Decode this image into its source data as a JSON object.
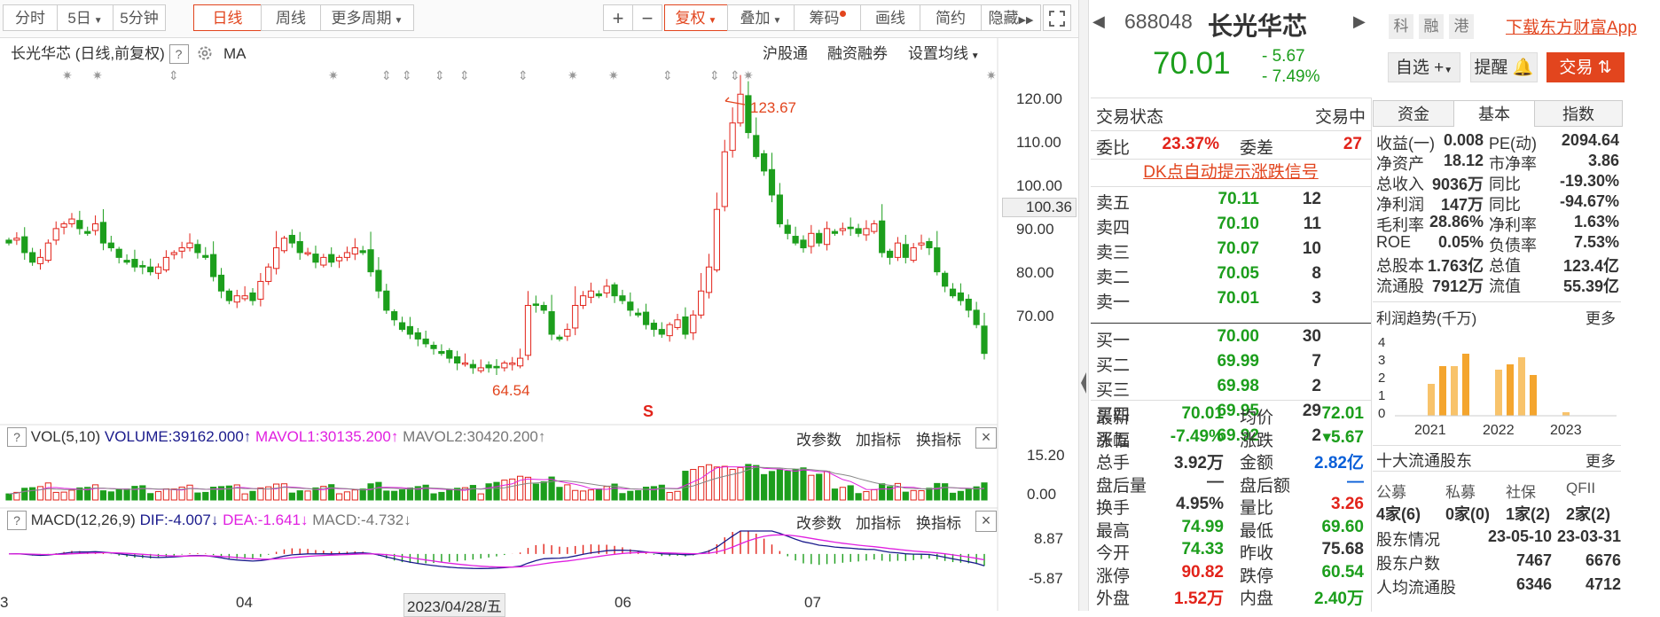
{
  "toolbar": {
    "periods": [
      "分时",
      "5日",
      "5分钟",
      "日线",
      "周线",
      "更多周期"
    ],
    "tools": [
      "+",
      "−",
      "复权",
      "叠加",
      "筹码",
      "画线",
      "简约",
      "隐藏"
    ]
  },
  "chart": {
    "header_name": "长光华芯",
    "header_mode": "(日线,前复权)",
    "header_ma": "MA",
    "links": [
      "沪股通",
      "融资融券",
      "设置均线"
    ],
    "price_high_label": "123.67",
    "price_low_label": "64.54",
    "current_marker": "100.36",
    "signal_mark": "S",
    "yticks": [
      "120.00",
      "110.00",
      "100.00",
      "90.00",
      "80.00",
      "70.00"
    ],
    "xticks": [
      "3",
      "04",
      "2023/04/28/五",
      "06",
      "07"
    ]
  },
  "volume": {
    "title": "VOL(5,10)",
    "volume": "VOLUME:39162.000",
    "mavol1": "MAVOL1:30135.200",
    "mavol2": "MAVOL2:30420.200",
    "ytop": "15.20",
    "ybottom": "0.00",
    "buttons": [
      "改参数",
      "加指标",
      "换指标"
    ]
  },
  "macd": {
    "title": "MACD(12,26,9)",
    "dif": "DIF:-4.007",
    "dea": "DEA:-1.641",
    "macd": "MACD:-4.732",
    "ytop": "8.87",
    "ybottom": "-5.87",
    "buttons": [
      "改参数",
      "加指标",
      "换指标"
    ]
  },
  "stock": {
    "code": "688048",
    "name": "长光华芯",
    "tags": [
      "科",
      "融",
      "港"
    ],
    "download": "下载东方财富App",
    "price": "70.01",
    "change": "- 5.67",
    "change_pct": "- 7.49%",
    "btn_watch": "自选",
    "btn_alert": "提醒",
    "btn_trade": "交易"
  },
  "status": {
    "label": "交易状态",
    "value": "交易中"
  },
  "ratio": {
    "wb_label": "委比",
    "wb_value": "23.37%",
    "wc_label": "委差",
    "wc_value": "27"
  },
  "dk": "DK点自动提示涨跌信号",
  "asks": [
    {
      "label": "卖五",
      "price": "70.11",
      "vol": "12"
    },
    {
      "label": "卖四",
      "price": "70.10",
      "vol": "11"
    },
    {
      "label": "卖三",
      "price": "70.07",
      "vol": "10"
    },
    {
      "label": "卖二",
      "price": "70.05",
      "vol": "8"
    },
    {
      "label": "卖一",
      "price": "70.01",
      "vol": "3"
    }
  ],
  "bids": [
    {
      "label": "买一",
      "price": "70.00",
      "vol": "30"
    },
    {
      "label": "买二",
      "price": "69.99",
      "vol": "7"
    },
    {
      "label": "买三",
      "price": "69.98",
      "vol": "2"
    },
    {
      "label": "买四",
      "price": "69.95",
      "vol": "29"
    },
    {
      "label": "买五",
      "price": "69.92",
      "vol": "2"
    }
  ],
  "quote": [
    {
      "l1": "最新",
      "v1": "70.01",
      "c1": "green",
      "l2": "均价",
      "v2": "72.01",
      "c2": "green"
    },
    {
      "l1": "涨幅",
      "v1": "-7.49%",
      "c1": "green",
      "l2": "涨跌",
      "v2": "▾5.67",
      "c2": "green"
    },
    {
      "l1": "总手",
      "v1": "3.92万",
      "c1": "black",
      "l2": "金额",
      "v2": "2.82亿",
      "c2": "blue"
    },
    {
      "l1": "盘后量",
      "v1": "—",
      "c1": "black",
      "l2": "盘后额",
      "v2": "—",
      "c2": "blue"
    },
    {
      "l1": "换手",
      "v1": "4.95%",
      "c1": "black",
      "l2": "量比",
      "v2": "3.26",
      "c2": "red"
    },
    {
      "l1": "最高",
      "v1": "74.99",
      "c1": "green",
      "l2": "最低",
      "v2": "69.60",
      "c2": "green"
    },
    {
      "l1": "今开",
      "v1": "74.33",
      "c1": "green",
      "l2": "昨收",
      "v2": "75.68",
      "c2": "black"
    },
    {
      "l1": "涨停",
      "v1": "90.82",
      "c1": "red",
      "l2": "跌停",
      "v2": "60.54",
      "c2": "green"
    },
    {
      "l1": "外盘",
      "v1": "1.52万",
      "c1": "red",
      "l2": "内盘",
      "v2": "2.40万",
      "c2": "green"
    }
  ],
  "tabs": [
    "资金",
    "基本",
    "指数"
  ],
  "fundamentals": [
    {
      "l1": "收益(一)",
      "v1": "0.008",
      "l2": "PE(动)",
      "v2": "2094.64"
    },
    {
      "l1": "净资产",
      "v1": "18.12",
      "l2": "市净率",
      "v2": "3.86"
    },
    {
      "l1": "总收入",
      "v1": "9036万",
      "l2": "同比",
      "v2": "-19.30%"
    },
    {
      "l1": "净利润",
      "v1": "147万",
      "l2": "同比",
      "v2": "-94.67%"
    },
    {
      "l1": "毛利率",
      "v1": "28.86%",
      "l2": "净利率",
      "v2": "1.63%"
    },
    {
      "l1": "ROE",
      "v1": "0.05%",
      "l2": "负债率",
      "v2": "7.53%"
    },
    {
      "l1": "总股本",
      "v1": "1.763亿",
      "l2": "总值",
      "v2": "123.4亿"
    },
    {
      "l1": "流通股",
      "v1": "7912万",
      "l2": "流值",
      "v2": "55.39亿"
    }
  ],
  "profit": {
    "title": "利润趋势(千万)",
    "more": "更多",
    "yticks": [
      "4",
      "3",
      "2",
      "1",
      "0"
    ],
    "years": [
      "2021",
      "2022",
      "2023"
    ]
  },
  "holders": {
    "title": "十大流通股东",
    "more": "更多",
    "types": [
      "公募",
      "私募",
      "社保",
      "QFII"
    ],
    "counts": [
      "4家(6)",
      "0家(0)",
      "1家(2)",
      "2家(2)"
    ],
    "rows": [
      {
        "label": "股东情况",
        "v1": "23-05-10",
        "v2": "23-03-31"
      },
      {
        "label": "股东户数",
        "v1": "7467",
        "v2": "6676"
      },
      {
        "label": "人均流通股",
        "v1": "6346",
        "v2": "4712"
      }
    ]
  },
  "colors": {
    "up": "#e2231a",
    "down": "#1c9e1c",
    "accent": "#e2451e",
    "blue": "#0a5fd8"
  },
  "chart_data": {
    "type": "candlestick",
    "title": "长光华芯 (日线,前复权)",
    "ylim": [
      62,
      127
    ],
    "annotations": {
      "high": 123.67,
      "low": 64.54,
      "marker": 100.36
    },
    "close": [
      93,
      94,
      91,
      89,
      90,
      93,
      96,
      97,
      98,
      96,
      95,
      97,
      93,
      92,
      90,
      89,
      88,
      88,
      87,
      88,
      90,
      91,
      92,
      93,
      91,
      90,
      86,
      83,
      81,
      82,
      82,
      81,
      85,
      88,
      92,
      94,
      93,
      91,
      91,
      89,
      90,
      89,
      90,
      91,
      92,
      91,
      87,
      83,
      79,
      77,
      75,
      74,
      73,
      72,
      71,
      70,
      69,
      68,
      68,
      67,
      67,
      67,
      67,
      68,
      68,
      69,
      80,
      80,
      79,
      74,
      73,
      75,
      80,
      82,
      83,
      82,
      84,
      82,
      81,
      79,
      78,
      76,
      75,
      74,
      76,
      77,
      74,
      78,
      83,
      88,
      100,
      112,
      118,
      124,
      116,
      111,
      108,
      103,
      97,
      95,
      93,
      92,
      95,
      93,
      96,
      95,
      96,
      96,
      95,
      96,
      97,
      91,
      90,
      93,
      90,
      92,
      93,
      92,
      87,
      84,
      82,
      81,
      79,
      76,
      70
    ],
    "volume_max": 15.2,
    "macd_range": [
      -5.87,
      8.87
    ]
  }
}
